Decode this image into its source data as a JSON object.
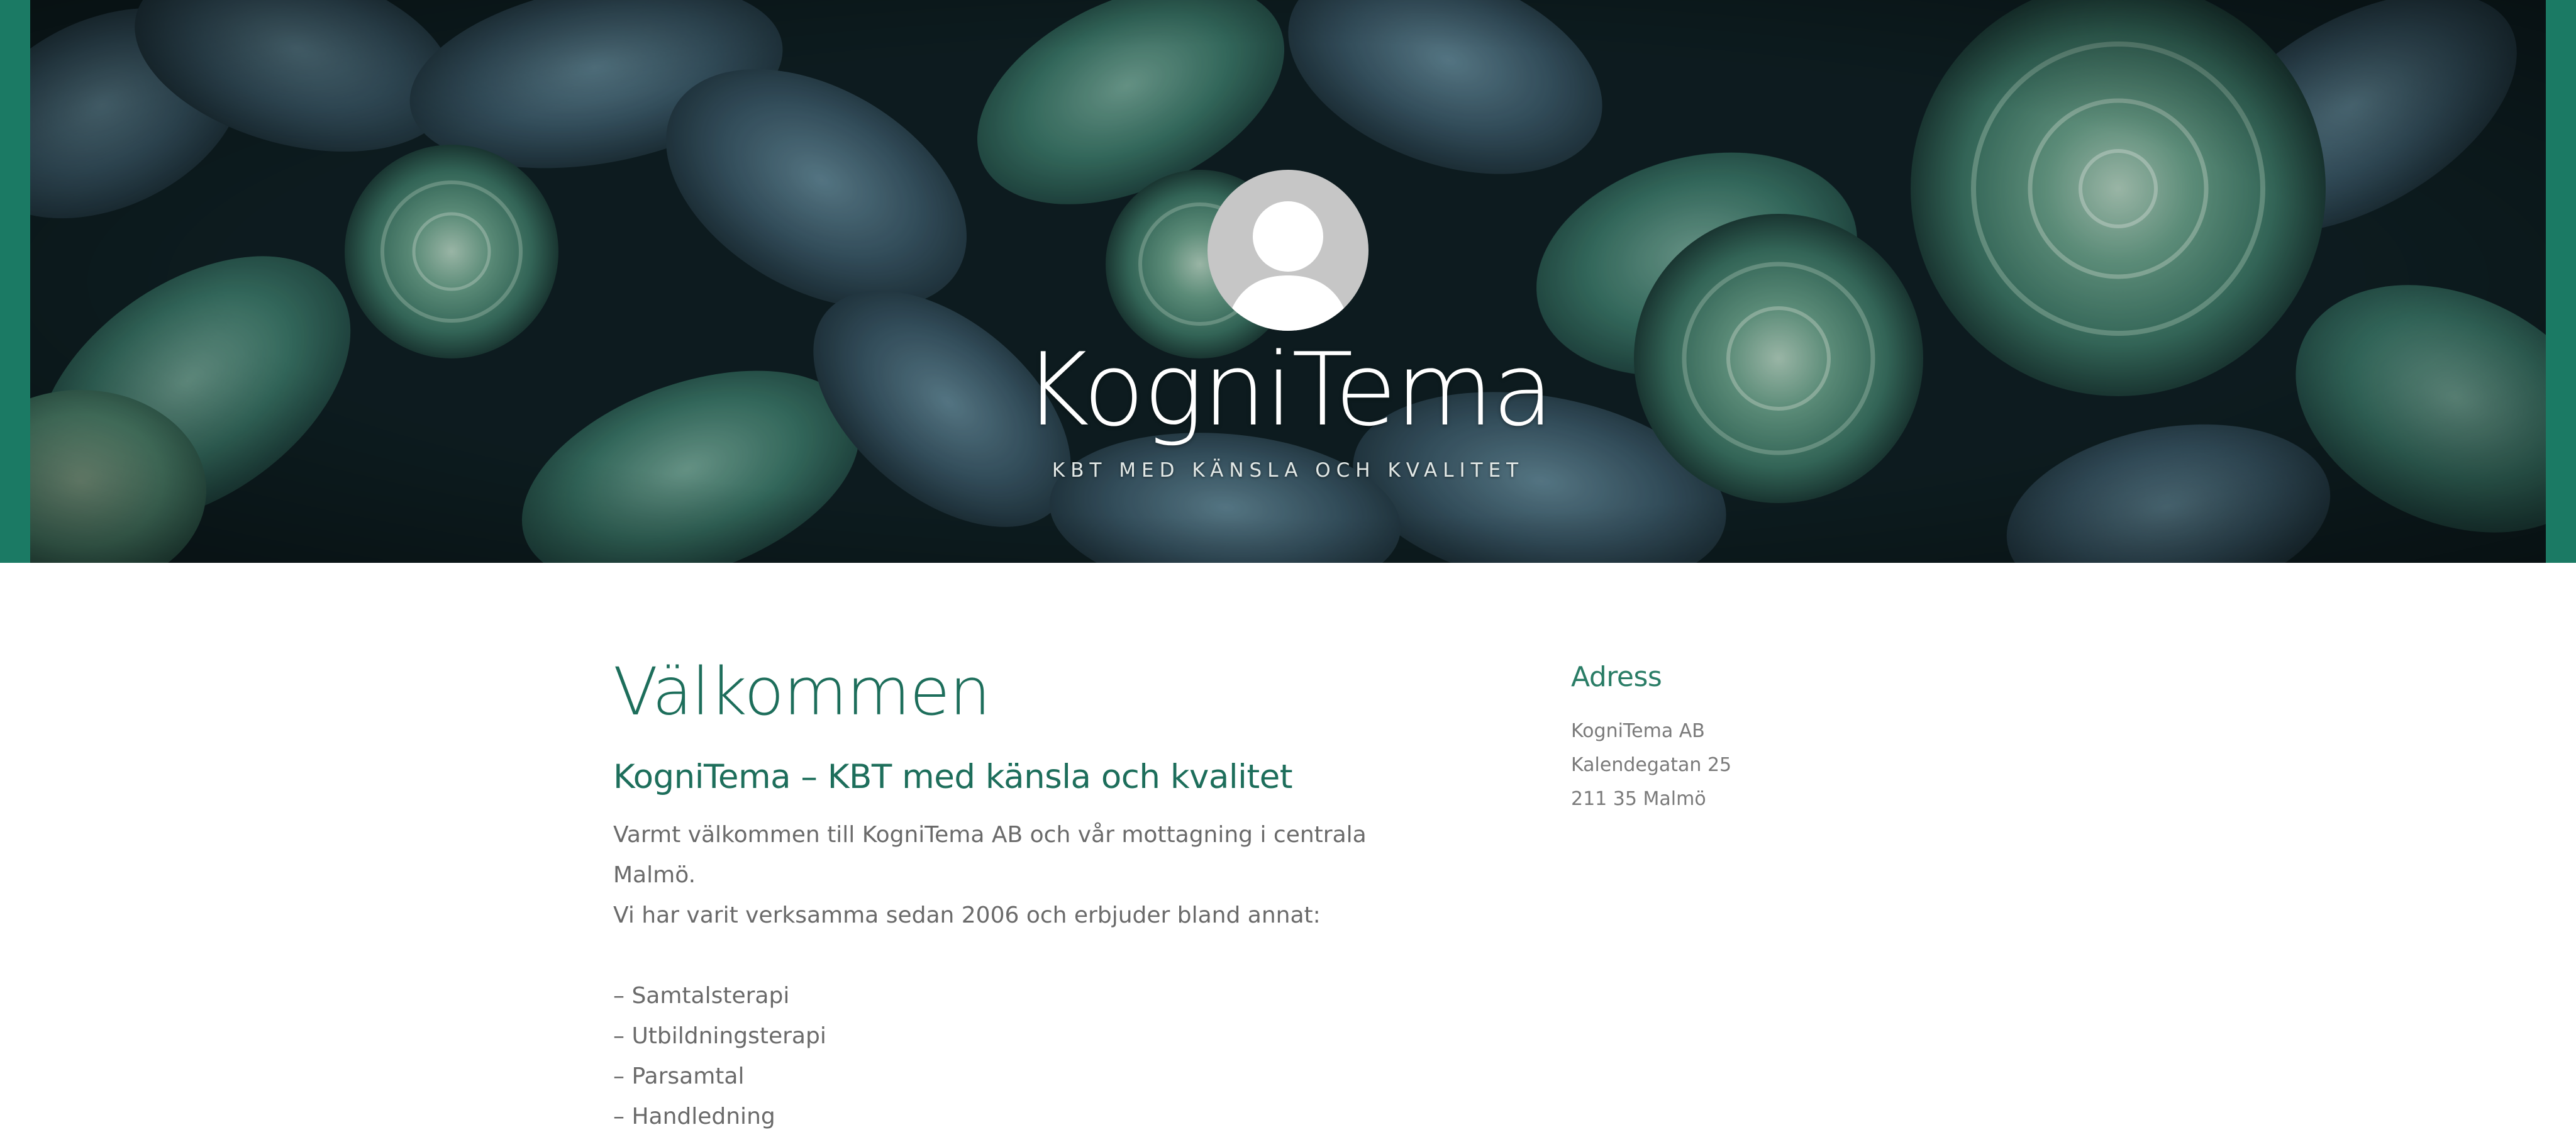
{
  "colors": {
    "accent": "#1d6e5b",
    "side_border": "#1b7a64",
    "body_text": "#6a6a6a",
    "avatar_bg": "#c6c6c6"
  },
  "header": {
    "background": "succulents-photo",
    "avatar_icon": "user-silhouette-icon",
    "site_title": "KogniTema",
    "tagline": "KBT MED KÄNSLA OCH KVALITET"
  },
  "main": {
    "title": "Välkommen",
    "subheading": "KogniTema – KBT med känsla och kvalitet",
    "intro_lines": [
      "Varmt välkommen till KogniTema AB och vår mottagning i centrala Malmö.",
      "Vi har varit verksamma sedan 2006 och erbjuder bland annat:"
    ],
    "services": [
      "– Samtalsterapi",
      "– Utbildningsterapi",
      "– Parsamtal",
      "– Handledning"
    ]
  },
  "sidebar": {
    "widget_title": "Adress",
    "address_lines": [
      "KogniTema AB",
      "Kalendegatan 25",
      "211 35 Malmö"
    ]
  }
}
